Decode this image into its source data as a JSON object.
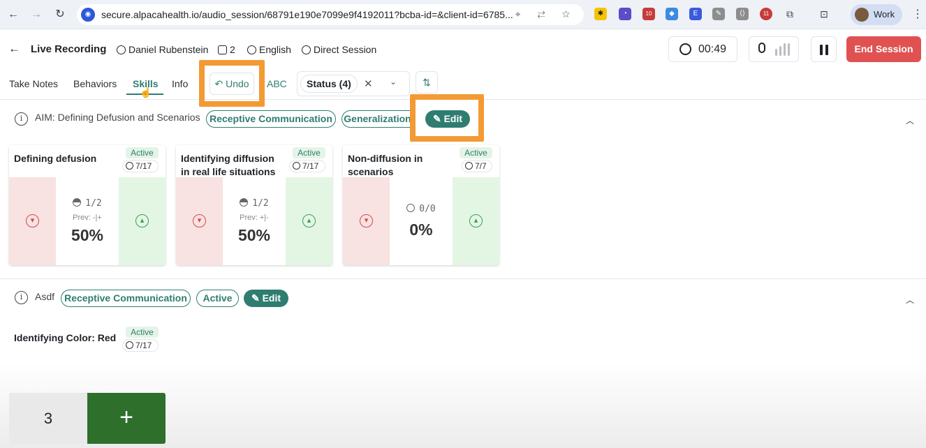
{
  "browser": {
    "url": "secure.alpacahealth.io/audio_session/68791e190e7099e9f4192011?bcba-id=&client-id=6785...",
    "profile": "Work",
    "ext_badges": [
      "10",
      "11"
    ]
  },
  "header": {
    "title": "Live Recording",
    "client": "Daniel Rubenstein",
    "participants": "2",
    "language": "English",
    "session_type": "Direct Session",
    "timer": "00:49",
    "end_label": "End Session"
  },
  "tabs": [
    {
      "label": "Take Notes"
    },
    {
      "label": "Behaviors"
    },
    {
      "label": "Skills"
    },
    {
      "label": "Info"
    }
  ],
  "toolbar": {
    "undo": "Undo",
    "abc": "ABC",
    "status_chip": "Status (4)"
  },
  "goals": [
    {
      "name": "AIM: Defining Defusion and Scenarios",
      "chips": [
        "Receptive Communication",
        "Generalization"
      ],
      "edit": "Edit",
      "cards": [
        {
          "title": "Defining defusion",
          "status": "Active",
          "date": "7/17",
          "fraction": "1/2",
          "prev": "Prev: -|+",
          "percent": "50%"
        },
        {
          "title": "Identifying diffusion in real life situations",
          "status": "Active",
          "date": "7/17",
          "fraction": "1/2",
          "prev": "Prev: +|-",
          "percent": "50%"
        },
        {
          "title": "Non-diffusion in scenarios",
          "status": "Active",
          "date": "7/7",
          "fraction": "0/0",
          "prev": "",
          "percent": "0%"
        }
      ]
    },
    {
      "name": "Asdf",
      "chips": [
        "Receptive Communication",
        "Active"
      ],
      "edit": "Edit",
      "cards": [
        {
          "title": "Identifying Color: Red",
          "status": "Active",
          "date": "7/17",
          "count": "3"
        }
      ]
    }
  ],
  "colors": {
    "accent": "#2f7d71",
    "danger": "#e05252",
    "highlight": "#f39a34",
    "counter_green": "#2e6f2c"
  }
}
